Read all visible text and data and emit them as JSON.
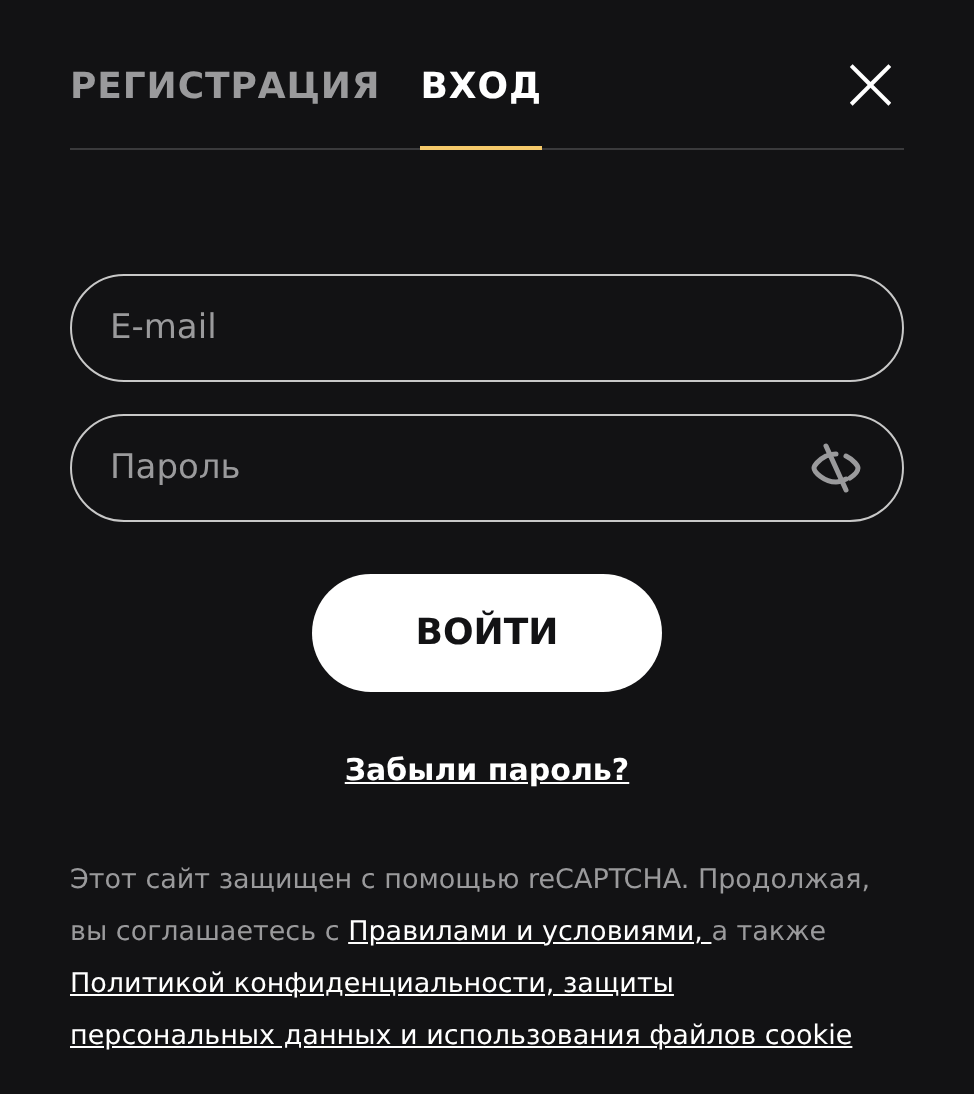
{
  "tabs": [
    {
      "label": "РЕГИСТРАЦИЯ",
      "selected": false
    },
    {
      "label": "ВХОД",
      "selected": true
    }
  ],
  "close": {
    "label": "×"
  },
  "fields": [
    {
      "placeholder": "E-mail",
      "kind": "email"
    },
    {
      "placeholder": "Пароль",
      "kind": "password"
    }
  ],
  "submit": {
    "label": "ВОЙТИ"
  },
  "forgot": {
    "label": "Забыли пароль?"
  },
  "legal": {
    "lines": [
      [
        {
          "kind": "text",
          "text": "Этот сайт защищен с помощью reCAPTCHA. Продолжая,"
        }
      ],
      [
        {
          "kind": "text",
          "text": "вы соглашаетесь с "
        },
        {
          "kind": "link",
          "text": "Правилами и условиями, "
        },
        {
          "kind": "text",
          "text": "а также"
        }
      ],
      [
        {
          "kind": "link",
          "text": "Политикой конфиденциальности, защиты"
        }
      ],
      [
        {
          "kind": "link",
          "text": "персональных данных и использования файлов cookie"
        }
      ]
    ]
  }
}
